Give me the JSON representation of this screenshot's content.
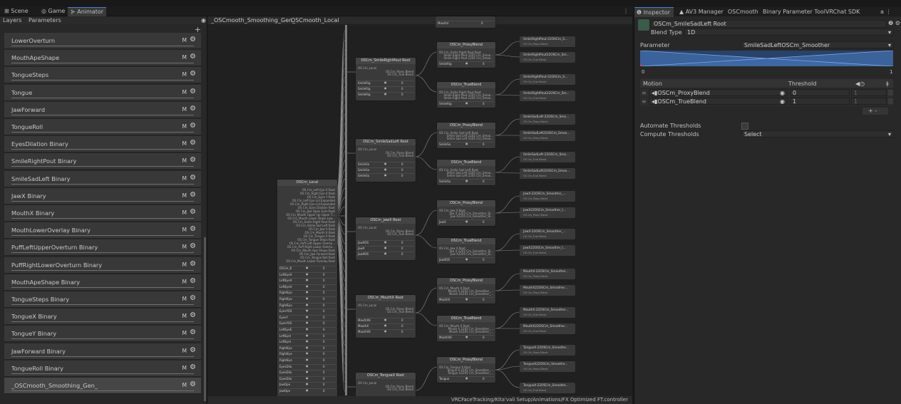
{
  "window_tabs": {
    "scene": "Scene",
    "game": "Game",
    "animator": "Animator",
    "menu": "⋮"
  },
  "layers_panel": {
    "tab_layers": "Layers",
    "tab_parameters": "Parameters",
    "add": "+",
    "items": [
      {
        "name": "LowerOverturn",
        "badge": "M"
      },
      {
        "name": "MouthApeShape",
        "badge": "M"
      },
      {
        "name": "TongueSteps",
        "badge": "M"
      },
      {
        "name": "Tongue",
        "badge": "M"
      },
      {
        "name": "JawForward",
        "badge": "M"
      },
      {
        "name": "TongueRoll",
        "badge": "M"
      },
      {
        "name": "EyesDilation Binary",
        "badge": "M"
      },
      {
        "name": "SmileRightPout Binary",
        "badge": "M"
      },
      {
        "name": "SmileSadLeft Binary",
        "badge": "M"
      },
      {
        "name": "JawX Binary",
        "badge": "M"
      },
      {
        "name": "MouthX Binary",
        "badge": "M"
      },
      {
        "name": "MouthLowerOverlay Binary",
        "badge": "M"
      },
      {
        "name": "PuffLeftUpperOverturn Binary",
        "badge": "M"
      },
      {
        "name": "PuffRightLowerOverturn Binary",
        "badge": "M"
      },
      {
        "name": "MouthApeShape Binary",
        "badge": "M"
      },
      {
        "name": "TongueSteps Binary",
        "badge": "M"
      },
      {
        "name": "TongueX Binary",
        "badge": "M"
      },
      {
        "name": "TongueY Binary",
        "badge": "M"
      },
      {
        "name": "JawForward Binary",
        "badge": "M"
      },
      {
        "name": "TongueRoll Binary",
        "badge": "M"
      },
      {
        "name": "_OSCmooth_Smoothing_Gen_",
        "badge": "M"
      }
    ]
  },
  "graph": {
    "breadcrumb": [
      "_OSCmooth_Smoothing_Gen_",
      "OSCmooth_Local"
    ],
    "footer_path": "VRCFaceTracking/Kita'vali Setup/Animations/FX Optimized FT.controller",
    "local_node": {
      "title": "OSCm_Local",
      "lines": [
        "OS Cm_Left Eye X Root",
        "OS Cm_Right Eye X Root",
        "OS Cm_Eyes Y Root",
        "OS Cm_Left Eye Lid Expanded",
        "OS Cm_Right Eye Lid Expanded",
        "OS Cm_Eyes Dilation Root",
        "OS Cm_Jaw Open Sum Root",
        "OS Cm_Mouth Upper Up Upper T...",
        "OS Cm_Mouth Lower Down Low...",
        "OS Cm_Smile Right Pout Root",
        "OS Cm_Smile Sad Left Root",
        "OS Cm_Jaw X Root",
        "OS Cm_Mouth X Root",
        "OS Cm_Tongue X Root",
        "OS Cm_Tongue Steps Root",
        "OS Cm_Puff Left Upper Overtu...",
        "OS Cm_Puff Right Lower Overtu...",
        "OS Cm_Mouth Ape Shape Root",
        "OS Cm_Jaw Forward Root",
        "OS Cm_Tongue Roll Root",
        "OS Cm_Mouth Lower Overlay Root"
      ],
      "params": [
        {
          "name": "OSCm_B",
          "value": "0"
        },
        {
          "name": "LeftEyeX",
          "value": "0"
        },
        {
          "name": "LeftEyeX",
          "value": "0"
        },
        {
          "name": "LeftEyeX",
          "value": "0"
        },
        {
          "name": "RightEye",
          "value": "0"
        },
        {
          "name": "RightEye",
          "value": "0"
        },
        {
          "name": "RightEye",
          "value": "0"
        },
        {
          "name": "EyesYOS",
          "value": "0"
        },
        {
          "name": "EyesY",
          "value": "0"
        },
        {
          "name": "EyesYOS",
          "value": "0"
        },
        {
          "name": "LeftEyeE",
          "value": "0"
        },
        {
          "name": "LeftEyeI",
          "value": "0"
        },
        {
          "name": "LeftEyeI",
          "value": "0"
        },
        {
          "name": "RightEye",
          "value": "0"
        },
        {
          "name": "RightEye",
          "value": "0"
        },
        {
          "name": "RightEye",
          "value": "0"
        },
        {
          "name": "EyesDila",
          "value": "0"
        },
        {
          "name": "EyesDila",
          "value": "0"
        },
        {
          "name": "EyesDila",
          "value": "0"
        },
        {
          "name": "JawOpe",
          "value": "0"
        },
        {
          "name": "JawOpe",
          "value": "0"
        }
      ]
    },
    "roots": [
      {
        "title": "OSCm_SmileRightPout Root",
        "sub": "OS Cm_Local",
        "outs": [
          "OS Cm_Proxy Blend",
          "OS Cm_True Blend"
        ],
        "params": [
          {
            "name": "SmileRig",
            "value": "0"
          },
          {
            "name": "SmileRig",
            "value": "0"
          },
          {
            "name": "SmileRig",
            "value": "0"
          }
        ]
      },
      {
        "title": "OSCm_SmileSadLeft Root",
        "sub": "OS Cm_Local",
        "outs": [
          "OS Cm_Proxy Blend",
          "OS Cm_True Blend"
        ],
        "params": [
          {
            "name": "SmileSa",
            "value": "0"
          },
          {
            "name": "SmileSa",
            "value": "0"
          },
          {
            "name": "SmileSa",
            "value": "0"
          }
        ]
      },
      {
        "title": "OSCm_JawX Root",
        "sub": "OS Cm_Local",
        "outs": [
          "OS Cm_Proxy Blend",
          "OS Cm_True Blend"
        ],
        "params": [
          {
            "name": "JawXOS",
            "value": "0"
          },
          {
            "name": "JawX",
            "value": "0"
          },
          {
            "name": "JawXOS",
            "value": "0"
          }
        ]
      },
      {
        "title": "OSCm_MouthX Root",
        "sub": "OS Cm_Local",
        "outs": [
          "OS Cm_Proxy Blend",
          "OS Cm_True Blend"
        ],
        "params": [
          {
            "name": "MouthX6",
            "value": "0"
          },
          {
            "name": "MouthX",
            "value": "0"
          },
          {
            "name": "MouthX6",
            "value": "0"
          }
        ]
      },
      {
        "title": "OSCm_TongueX Root",
        "sub": "OS Cm_Local",
        "outs": [
          "OS Cm_Proxy Blend",
          "OS Cm_True Blend"
        ],
        "params": []
      }
    ],
    "blends": [
      {
        "title": "OSCm_ProxyBlend",
        "l1": "OS Cm_Smile Right Pout Root",
        "l2": "Smile Right Pout 2205 Cm_Smoo...",
        "l3": "Smile Right Pout 2205 Cm_Smoo...",
        "param": "SmileRig",
        "value": "0"
      },
      {
        "title": "OSCm_TrueBlend",
        "l1": "OS Cm_Smile Right Pout Root",
        "l2": "Smile Right Pout 2205 Cm_Smoo...",
        "l3": "Smile Right Pout 2205 Cm_Smoo...",
        "param": "SmileRig",
        "value": "0"
      },
      {
        "title": "OSCm_ProxyBlend",
        "l1": "OS Cm_Smile Sad Left Root",
        "l2": "Smile Sad Left 2205 Cm_Smoo...",
        "l3": "Smile Sad Left 2205 Cm_Smoo...",
        "param": "SmileSa",
        "value": "0"
      },
      {
        "title": "OSCm_TrueBlend",
        "l1": "OS Cm_Smile Sad Left Root",
        "l2": "Smile Sad Left 2205 Cm_Smoo...",
        "l3": "Smile Sad Left 2205 Cm_Smoo...",
        "param": "SmileSa",
        "value": "0"
      },
      {
        "title": "OSCm_ProxyBlend",
        "l1": "OS Cm_Jaw X Root",
        "l2": "Jaw X 2205 Cm_Smoother_Sl...",
        "l3": "Jaw X2205 Cm_Smoother_Sl...",
        "param": "JawX",
        "value": "0"
      },
      {
        "title": "OSCm_TrueBlend",
        "l1": "OS Cm_Jaw X Root",
        "l2": "Jaw X 2205 Cm_Smoother_Sl...",
        "l3": "Jaw X2205 Cm_Smoother_Sl...",
        "param": "JawXOS",
        "value": "0"
      },
      {
        "title": "OSCm_ProxyBlend",
        "l1": "OS Cm_Mouth X Root",
        "l2": "Mouth X 2205 Cm_Smoother_...",
        "l3": "Mouth X2205 Cm_Smoother_...",
        "param": "MouthX",
        "value": "0"
      },
      {
        "title": "OSCm_TrueBlend",
        "l1": "OS Cm_Mouth X Root",
        "l2": "Mouth X 2205 Cm_Smoother_...",
        "l3": "Mouth X2205 Cm_Smoother_...",
        "param": "MouthX6",
        "value": "0"
      },
      {
        "title": "OSCm_ProxyBlend",
        "l1": "OS Cm_Tongue X Root",
        "l2": "Tongue X 2205 Cm_Smoother_...",
        "l3": "Tongue X2205 Cm_Smoother_...",
        "param": "Tongue",
        "value": "0"
      }
    ],
    "leaves": [
      {
        "name": "SmileRightPout-22OSCm_S...",
        "sub": "OS Cm_Proxy Blend"
      },
      {
        "name": "SmileRightPout22OSCm_Sm...",
        "sub": "OS Cm_True Blend"
      },
      {
        "name": "SmileRightPout-22OSCm_S...",
        "sub": "OS Cm_True Blend"
      },
      {
        "name": "SmileRightPout22OSCm_Sm...",
        "sub": "OS Cm_True Blend"
      },
      {
        "name": "SmileSadLeft-22OSCm_Smo...",
        "sub": "OS Cm_Proxy Blend"
      },
      {
        "name": "SmileSadLeft22OSCm_Smoo...",
        "sub": "OS Cm_Proxy Blend"
      },
      {
        "name": "SmileSadLeft-22OSCm_Smo...",
        "sub": "OS Cm_True Blend"
      },
      {
        "name": "SmileSadLeft22OSCm_Smoo...",
        "sub": "OS Cm_True Blend"
      },
      {
        "name": "JawX-22OSCm_Smoother_...",
        "sub": "OS Cm_Proxy Blend"
      },
      {
        "name": "JawX22OSCm_Smoother_I...",
        "sub": "OS Cm_Proxy Blend"
      },
      {
        "name": "JawX-22OSCm_Smoother_...",
        "sub": "OS Cm_True Blend"
      },
      {
        "name": "JawX22OSCm_Smoother_I...",
        "sub": "OS Cm_True Blend"
      },
      {
        "name": "MouthX-22OSCm_Smoother...",
        "sub": "OS Cm_Proxy Blend"
      },
      {
        "name": "MouthX22OSCm_Smoother...",
        "sub": "OS Cm_Proxy Blend"
      },
      {
        "name": "MouthX-22OSCm_Smoother...",
        "sub": "OS Cm_True Blend"
      },
      {
        "name": "MouthX22OSCm_Smoother...",
        "sub": "OS Cm_True Blend"
      },
      {
        "name": "TongueX-22OSCm_Smoothe...",
        "sub": "OS Cm_Proxy Blend"
      },
      {
        "name": "TongueX22OSCm_Smoothe...",
        "sub": "OS Cm_Proxy Blend"
      },
      {
        "name": "TongueX-22OSCm_Smoothe...",
        "sub": "OS Cm_True Blend"
      }
    ],
    "top_partial": {
      "param": "MouthU",
      "value": "0"
    }
  },
  "inspector": {
    "tabs": [
      "Inspector",
      "AV3 Manager",
      "OSCmooth",
      "Binary Parameter Tool",
      "VRChat SDK"
    ],
    "menu": "⋮",
    "object_name": "OSCm_SmileSadLeft Root",
    "blend_type_label": "Blend Type",
    "blend_type_value": "1D",
    "parameter_label": "Parameter",
    "parameter_value": "SmileSadLeftOSCm_Smoother",
    "axis_min": "0",
    "axis_max": "1",
    "motion_header": "Motion",
    "threshold_header": "Threshold",
    "motions": [
      {
        "name": "OSCm_ProxyBlend",
        "threshold": "0",
        "speed": "1"
      },
      {
        "name": "OSCm_TrueBlend",
        "threshold": "1",
        "speed": "1"
      }
    ],
    "add_remove": "+  -",
    "automate_label": "Automate Thresholds",
    "compute_label": "Compute Thresholds",
    "compute_value": "Select"
  },
  "colors": {
    "accent": "#4a7fd4",
    "panel": "#282828",
    "graph_bg": "#202020",
    "node": "#3a3a3a"
  }
}
